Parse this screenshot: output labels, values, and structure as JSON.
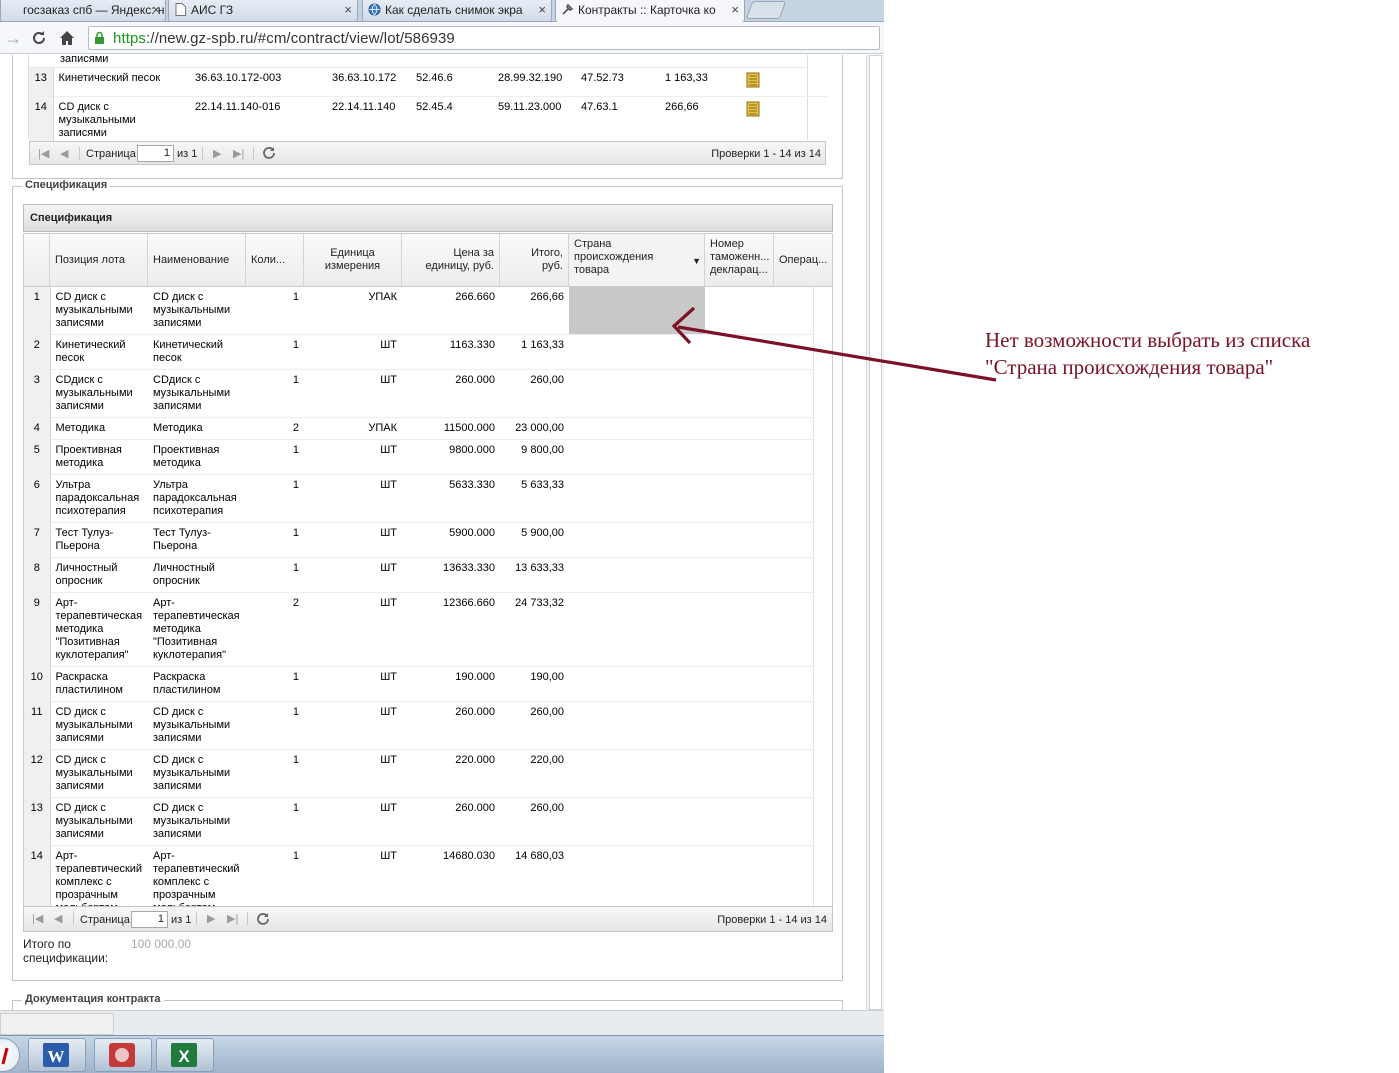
{
  "browser": {
    "tabs": [
      {
        "title": "госзаказ спб — Яндекс: н",
        "icon": "yandex-icon"
      },
      {
        "title": "АИС ГЗ",
        "icon": "page-icon"
      },
      {
        "title": "Как сделать снимок экра",
        "icon": "globe-icon"
      },
      {
        "title": "Контракты :: Карточка ко",
        "icon": "tools-icon"
      }
    ],
    "url_scheme": "https",
    "url_rest": "://new.gz-spb.ru/#cm/contract/view/lot/586939"
  },
  "top_grid": {
    "partial_row_text": "записями",
    "rows": [
      {
        "n": "13",
        "name": "Кинетический песок",
        "c1": "36.63.10.172-003",
        "c2": "36.63.10.172",
        "c3": "52.46.6",
        "c4": "28.99.32.190",
        "c5": "47.52.73",
        "sum": "1 163,33"
      },
      {
        "n": "14",
        "name": "CD диск с музыкальными записями",
        "c1": "22.14.11.140-016",
        "c2": "22.14.11.140",
        "c3": "52.45.4",
        "c4": "59.11.23.000",
        "c5": "47.63.1",
        "sum": "266,66"
      }
    ],
    "pager": {
      "page_label": "Страница",
      "page": "1",
      "of_label": "из 1",
      "summary": "Проверки 1 - 14 из 14"
    }
  },
  "spec": {
    "legend": "Спецификация",
    "grid_title": "Спецификация",
    "columns": [
      "Позиция лота",
      "Наименование",
      "Коли...",
      "Единица измерения",
      "Цена за единицу, руб.",
      "Итого, руб.",
      "Страна происхождения товара",
      "Номер таможенн... декларац...",
      "Операц..."
    ],
    "rows": [
      {
        "n": "1",
        "pos": "CD диск с музыкальными записями",
        "name": "CD диск с музыкальными записями",
        "qty": "1",
        "unit": "УПАК",
        "price": "266.660",
        "total": "266,66"
      },
      {
        "n": "2",
        "pos": "Кинетический песок",
        "name": "Кинетический песок",
        "qty": "1",
        "unit": "ШТ",
        "price": "1163.330",
        "total": "1 163,33"
      },
      {
        "n": "3",
        "pos": "CDдиск с музыкальными записями",
        "name": "CDдиск с музыкальными записями",
        "qty": "1",
        "unit": "ШТ",
        "price": "260.000",
        "total": "260,00"
      },
      {
        "n": "4",
        "pos": "Методика",
        "name": "Методика",
        "qty": "2",
        "unit": "УПАК",
        "price": "11500.000",
        "total": "23 000,00"
      },
      {
        "n": "5",
        "pos": "Проективная методика",
        "name": "Проективная методика",
        "qty": "1",
        "unit": "ШТ",
        "price": "9800.000",
        "total": "9 800,00"
      },
      {
        "n": "6",
        "pos": "Ультра парадоксальная психотерапия",
        "name": "Ультра парадоксальная психотерапия",
        "qty": "1",
        "unit": "ШТ",
        "price": "5633.330",
        "total": "5 633,33"
      },
      {
        "n": "7",
        "pos": "Тест Тулуз-Пьерона",
        "name": "Тест Тулуз-Пьерона",
        "qty": "1",
        "unit": "ШТ",
        "price": "5900.000",
        "total": "5 900,00"
      },
      {
        "n": "8",
        "pos": "Личностный опросник",
        "name": "Личностный опросник",
        "qty": "1",
        "unit": "ШТ",
        "price": "13633.330",
        "total": "13 633,33"
      },
      {
        "n": "9",
        "pos": "Арт-терапевтическая методика \"Позитивная куклотерапия\"",
        "name": "Арт-терапевтическая методика \"Позитивная куклотерапия\"",
        "qty": "2",
        "unit": "ШТ",
        "price": "12366.660",
        "total": "24 733,32"
      },
      {
        "n": "10",
        "pos": "Раскраска пластилином",
        "name": "Раскраска пластилином",
        "qty": "1",
        "unit": "ШТ",
        "price": "190.000",
        "total": "190,00"
      },
      {
        "n": "11",
        "pos": "CD диск с музыкальными записями",
        "name": "CD диск с музыкальными записями",
        "qty": "1",
        "unit": "ШТ",
        "price": "260.000",
        "total": "260,00"
      },
      {
        "n": "12",
        "pos": "CD диск с музыкальными записями",
        "name": "CD диск с музыкальными записями",
        "qty": "1",
        "unit": "ШТ",
        "price": "220.000",
        "total": "220,00"
      },
      {
        "n": "13",
        "pos": "CD диск с музыкальными записями",
        "name": "CD диск с музыкальными записями",
        "qty": "1",
        "unit": "ШТ",
        "price": "260.000",
        "total": "260,00"
      },
      {
        "n": "14",
        "pos": "Арт-терапевтический комплекс с прозрачным мольбертом",
        "name": "Арт-терапевтический комплекс с прозрачным мольбертом",
        "qty": "1",
        "unit": "ШТ",
        "price": "14680.030",
        "total": "14 680,03"
      }
    ],
    "pager": {
      "page_label": "Страница",
      "page": "1",
      "of_label": "из 1",
      "summary": "Проверки 1 - 14 из 14"
    },
    "total_label": "Итого по спецификации:",
    "total_value": "100 000,00"
  },
  "docs": {
    "legend": "Документация контракта"
  },
  "annotation": "Нет возможности выбрать из списка \"Страна происхождения товара\"",
  "colors": {
    "annotation": "#7b1226",
    "selected_cell": "#c8c8c8"
  },
  "taskbar": {
    "apps": [
      "start-icon",
      "word-icon",
      "app-icon",
      "excel-icon"
    ]
  }
}
